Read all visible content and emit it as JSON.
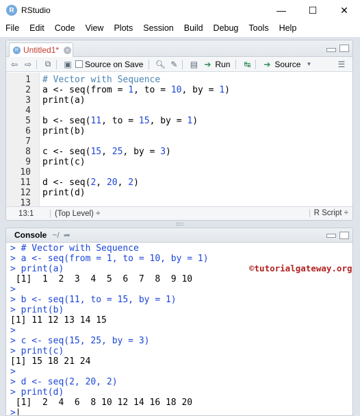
{
  "window": {
    "title": "RStudio",
    "logo_letter": "R",
    "min_glyph": "—",
    "max_glyph": "☐",
    "close_glyph": "✕"
  },
  "menu": [
    "File",
    "Edit",
    "Code",
    "View",
    "Plots",
    "Session",
    "Build",
    "Debug",
    "Tools",
    "Help"
  ],
  "source": {
    "tab_label": "Untitled1*",
    "toolbar": {
      "source_on_save": "Source on Save",
      "run": "Run",
      "source": "Source"
    },
    "lines": [
      {
        "n": "1",
        "type": "comment",
        "text": "# Vector with Sequence"
      },
      {
        "n": "2",
        "type": "code",
        "parts": [
          [
            "tx",
            "a <- seq(from = "
          ],
          [
            "num",
            "1"
          ],
          [
            "tx",
            ", to = "
          ],
          [
            "num",
            "10"
          ],
          [
            "tx",
            ", by = "
          ],
          [
            "num",
            "1"
          ],
          [
            "tx",
            ")"
          ]
        ]
      },
      {
        "n": "3",
        "type": "code",
        "parts": [
          [
            "tx",
            "print(a)"
          ]
        ]
      },
      {
        "n": "4",
        "type": "code",
        "parts": []
      },
      {
        "n": "5",
        "type": "code",
        "parts": [
          [
            "tx",
            "b <- seq("
          ],
          [
            "num",
            "11"
          ],
          [
            "tx",
            ", to = "
          ],
          [
            "num",
            "15"
          ],
          [
            "tx",
            ", by = "
          ],
          [
            "num",
            "1"
          ],
          [
            "tx",
            ")"
          ]
        ]
      },
      {
        "n": "6",
        "type": "code",
        "parts": [
          [
            "tx",
            "print(b)"
          ]
        ]
      },
      {
        "n": "7",
        "type": "code",
        "parts": []
      },
      {
        "n": "8",
        "type": "code",
        "parts": [
          [
            "tx",
            "c <- seq("
          ],
          [
            "num",
            "15"
          ],
          [
            "tx",
            ", "
          ],
          [
            "num",
            "25"
          ],
          [
            "tx",
            ", by = "
          ],
          [
            "num",
            "3"
          ],
          [
            "tx",
            ")"
          ]
        ]
      },
      {
        "n": "9",
        "type": "code",
        "parts": [
          [
            "tx",
            "print(c)"
          ]
        ]
      },
      {
        "n": "10",
        "type": "code",
        "parts": []
      },
      {
        "n": "11",
        "type": "code",
        "parts": [
          [
            "tx",
            "d <- seq("
          ],
          [
            "num",
            "2"
          ],
          [
            "tx",
            ", "
          ],
          [
            "num",
            "20"
          ],
          [
            "tx",
            ", "
          ],
          [
            "num",
            "2"
          ],
          [
            "tx",
            ")"
          ]
        ]
      },
      {
        "n": "12",
        "type": "code",
        "parts": [
          [
            "tx",
            "print(d)"
          ]
        ]
      },
      {
        "n": "13",
        "type": "code",
        "parts": []
      }
    ],
    "status": {
      "position": "13:1",
      "scope": "(Top Level) ÷",
      "file_type": "R Script ÷"
    }
  },
  "console": {
    "title": "Console",
    "path": "~/",
    "watermark": "©tutorialgateway.org",
    "lines": [
      {
        "kind": "prompt",
        "text": "> # Vector with Sequence"
      },
      {
        "kind": "prompt",
        "text": "> a <- seq(from = 1, to = 10, by = 1)"
      },
      {
        "kind": "prompt",
        "text": "> print(a)"
      },
      {
        "kind": "output",
        "text": " [1]  1  2  3  4  5  6  7  8  9 10"
      },
      {
        "kind": "prompt",
        "text": ">"
      },
      {
        "kind": "prompt",
        "text": "> b <- seq(11, to = 15, by = 1)"
      },
      {
        "kind": "prompt",
        "text": "> print(b)"
      },
      {
        "kind": "output",
        "text": "[1] 11 12 13 14 15"
      },
      {
        "kind": "prompt",
        "text": ">"
      },
      {
        "kind": "prompt",
        "text": "> c <- seq(15, 25, by = 3)"
      },
      {
        "kind": "prompt",
        "text": "> print(c)"
      },
      {
        "kind": "output",
        "text": "[1] 15 18 21 24"
      },
      {
        "kind": "prompt",
        "text": ">"
      },
      {
        "kind": "prompt",
        "text": "> d <- seq(2, 20, 2)"
      },
      {
        "kind": "prompt",
        "text": "> print(d)"
      },
      {
        "kind": "output",
        "text": " [1]  2  4  6  8 10 12 14 16 18 20"
      },
      {
        "kind": "prompt",
        "text": ">"
      }
    ]
  },
  "colors": {
    "comment": "#4a84b4",
    "number": "#1b45d8",
    "prompt": "#1b45d8",
    "tab_modified": "#c0392b",
    "watermark": "#b22222",
    "workspace_bg": "#dfe4ea"
  }
}
